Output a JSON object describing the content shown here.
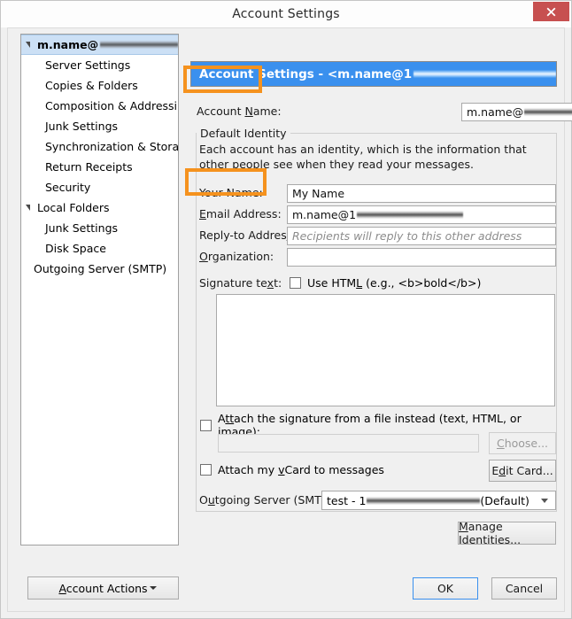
{
  "window": {
    "title": "Account Settings",
    "close_label": "×"
  },
  "sidebar": {
    "items": [
      {
        "label": "m.name@",
        "level": 0,
        "selected": true,
        "twisty": true,
        "redacted": true
      },
      {
        "label": "Server Settings",
        "level": 1,
        "selected": false,
        "twisty": false,
        "redacted": false
      },
      {
        "label": "Copies & Folders",
        "level": 1,
        "selected": false,
        "twisty": false,
        "redacted": false
      },
      {
        "label": "Composition & Addressing",
        "level": 1,
        "selected": false,
        "twisty": false,
        "redacted": false
      },
      {
        "label": "Junk Settings",
        "level": 1,
        "selected": false,
        "twisty": false,
        "redacted": false
      },
      {
        "label": "Synchronization & Storage",
        "level": 1,
        "selected": false,
        "twisty": false,
        "redacted": false
      },
      {
        "label": "Return Receipts",
        "level": 1,
        "selected": false,
        "twisty": false,
        "redacted": false
      },
      {
        "label": "Security",
        "level": 1,
        "selected": false,
        "twisty": false,
        "redacted": false
      },
      {
        "label": "Local Folders",
        "level": 0,
        "selected": false,
        "twisty": true,
        "redacted": false
      },
      {
        "label": "Junk Settings",
        "level": 1,
        "selected": false,
        "twisty": false,
        "redacted": false
      },
      {
        "label": "Disk Space",
        "level": 1,
        "selected": false,
        "twisty": false,
        "redacted": false
      },
      {
        "label": "Outgoing Server (SMTP)",
        "level": 2,
        "selected": false,
        "twisty": false,
        "redacted": false
      }
    ],
    "account_actions_label": "Account Actions",
    "account_actions_accel": "A"
  },
  "panel": {
    "header_prefix": "Account Settings - <m.name@1",
    "account_name": {
      "label_pre": "Account ",
      "label_accel": "N",
      "label_post": "ame:",
      "value": "m.name@"
    },
    "group": {
      "legend": "Default Identity",
      "description": "Each account has an identity, which is the information that other people see when they read your messages."
    },
    "fields": [
      {
        "label_pre": "Your Name:",
        "label_accel": "",
        "label_post": "",
        "value": "My Name",
        "placeholder": "",
        "redacted": false
      },
      {
        "label_pre": "",
        "label_accel": "E",
        "label_post": "mail Address:",
        "value": "m.name@1",
        "placeholder": "",
        "redacted": true
      },
      {
        "label_pre": "Reply-to Addres",
        "label_accel": "s",
        "label_post": ":",
        "value": "",
        "placeholder": "Recipients will reply to this other address",
        "redacted": false
      },
      {
        "label_pre": "",
        "label_accel": "O",
        "label_post": "rganization:",
        "value": "",
        "placeholder": "",
        "redacted": false
      }
    ],
    "signature": {
      "label_pre": "Signature te",
      "label_accel": "x",
      "label_post": "t:",
      "use_html_pre": "Use HTM",
      "use_html_accel": "L",
      "use_html_post": " (e.g., <b>bold</b>)",
      "use_html_checked": false,
      "text": ""
    },
    "attach_file": {
      "label_pre": "A",
      "label_accel": "tt",
      "label_post": "ach the signature from a file instead (text, HTML, or image):",
      "checked": false,
      "path_value": "",
      "choose_pre": "",
      "choose_accel": "C",
      "choose_post": "hoose...",
      "choose_disabled": true
    },
    "attach_vcard": {
      "label_pre": "Attach my ",
      "label_accel": "v",
      "label_post": "Card to messages",
      "checked": false,
      "edit_pre": "E",
      "edit_accel": "d",
      "edit_post": "it Card..."
    },
    "outgoing_server": {
      "label_pre": "O",
      "label_accel": "u",
      "label_post": "tgoing Server (SMTP):",
      "value_prefix": "test - 1",
      "value_suffix": "(Default)"
    },
    "manage_identities": {
      "pre": "",
      "accel": "M",
      "post": "anage Identities..."
    }
  },
  "footer": {
    "ok_label": "OK",
    "cancel_label": "Cancel"
  },
  "annotations": {
    "highlight_color": "#f5921e",
    "boxes": [
      {
        "name": "account-name-highlight"
      },
      {
        "name": "email-address-highlight"
      }
    ]
  }
}
